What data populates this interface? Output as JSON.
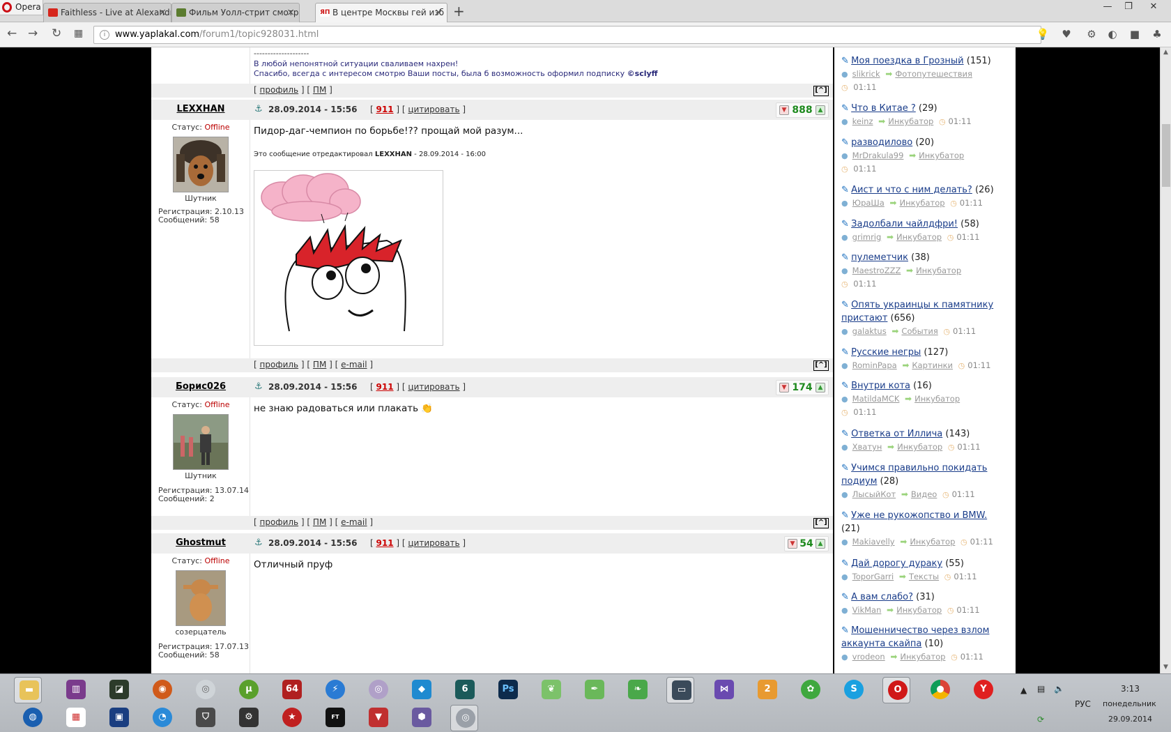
{
  "browser": {
    "brand": "Opera",
    "tabs": [
      {
        "title": "Faithless - Live at Alexandr",
        "fav_color": "#d6261c"
      },
      {
        "title": "Фильм Уолл-стрит смотр",
        "fav_color": "#5b7c2f"
      },
      {
        "title": "В центре Москвы гей изб",
        "fav_color": "#cc1111",
        "active": true
      }
    ],
    "url_host": "www.yaplakal.com",
    "url_path": "/forum1/topic928031.html"
  },
  "forum": {
    "prev_post": {
      "sig_line": "--------------------",
      "sig_text1": "В любой непонятной ситуации сваливаем нахрен!",
      "sig_text2": "Спасибо, всегда с интересом смотрю Ваши посты, была б возможность оформил подписку",
      "sig_author": "©sclyff",
      "footer": {
        "profile": "профиль",
        "pm": "ПМ"
      }
    },
    "posts": [
      {
        "user": "LEXXHAN",
        "date": "28.09.2014 - 15:56",
        "n911": "911",
        "quote": "цитировать",
        "rating": "888",
        "status_label": "Статус:",
        "status": "Offline",
        "rank": "Шутник",
        "reg_label": "Регистрация: 2.10.13",
        "msgs_label": "Сообщений: 58",
        "text": "Пидор-даг-чемпион по борьбе!?? прощай мой разум...",
        "edit_note_prefix": "Это сообщение отредактировал",
        "edit_note_user": "LEXXHAN",
        "edit_note_date": "- 28.09.2014 - 16:00",
        "footer": {
          "profile": "профиль",
          "pm": "ПМ",
          "email": "e-mail"
        }
      },
      {
        "user": "Борис026",
        "date": "28.09.2014 - 15:56",
        "n911": "911",
        "quote": "цитировать",
        "rating": "174",
        "status_label": "Статус:",
        "status": "Offline",
        "rank": "Шутник",
        "reg_label": "Регистрация: 13.07.14",
        "msgs_label": "Сообщений: 2",
        "text": "не знаю радоваться или плакать",
        "footer": {
          "profile": "профиль",
          "pm": "ПМ",
          "email": "e-mail"
        }
      },
      {
        "user": "Ghostmut",
        "date": "28.09.2014 - 15:56",
        "n911": "911",
        "quote": "цитировать",
        "rating": "54",
        "status_label": "Статус:",
        "status": "Offline",
        "rank": "созерцатель",
        "reg_label": "Регистрация: 17.07.13",
        "msgs_label": "Сообщений: 58",
        "text": "Отличный пруф"
      }
    ]
  },
  "sidebar": {
    "items": [
      {
        "title": "Моя поездка в Грозный",
        "count": "(151)",
        "user": "slikrick",
        "section": "Фотопутешествия",
        "time": "01:11"
      },
      {
        "title": "Что в Китае ?",
        "count": "(29)",
        "user": "keinz",
        "section": "Инкубатор",
        "time": "01:11"
      },
      {
        "title": "разводилово",
        "count": "(20)",
        "user": "MrDrakula99",
        "section": "Инкубатор",
        "time": "01:11"
      },
      {
        "title": "Аист и что с ним делать?",
        "count": "(26)",
        "user": "ЮраШа",
        "section": "Инкубатор",
        "time": "01:11"
      },
      {
        "title": "Задолбали чайлдфри!",
        "count": "(58)",
        "user": "grimrig",
        "section": "Инкубатор",
        "time": "01:11"
      },
      {
        "title": "пулеметчик",
        "count": "(38)",
        "user": "MaestroZZZ",
        "section": "Инкубатор",
        "time": "01:11"
      },
      {
        "title1": "Опять украинцы к памятнику",
        "title2": "пристают",
        "count": "(656)",
        "user": "galaktus",
        "section": "События",
        "time": "01:11"
      },
      {
        "title": "Русские негры",
        "count": "(127)",
        "user": "RominPapa",
        "section": "Картинки",
        "time": "01:11"
      },
      {
        "title": "Внутри кота",
        "count": "(16)",
        "user": "MatildaMCK",
        "section": "Инкубатор",
        "time": "01:11"
      },
      {
        "title": "Ответка от Иллича",
        "count": "(143)",
        "user": "Хватун",
        "section": "Инкубатор",
        "time": "01:11"
      },
      {
        "title1": "Учимся правильно покидать",
        "title2": "подиум",
        "count": "(28)",
        "user": "ЛысыйКот",
        "section": "Видео",
        "time": "01:11"
      },
      {
        "title1": "Уже не рукожопство и BMW.",
        "count": "(21)",
        "user": "Makiavelly",
        "section": "Инкубатор",
        "time": "01:11"
      },
      {
        "title": "Дай дорогу дураку",
        "count": "(55)",
        "user": "ToporGarri",
        "section": "Тексты",
        "time": "01:11"
      },
      {
        "title": "А вам слабо?",
        "count": "(31)",
        "user": "VikMan",
        "section": "Инкубатор",
        "time": "01:11"
      },
      {
        "title1": "Мошенничество через взлом",
        "title2": "аккаунта скайпа",
        "count": "(10)",
        "user": "vrodeon",
        "section": "Инкубатор",
        "time": "01:11"
      }
    ]
  },
  "taskbar": {
    "time": "3:13",
    "day": "понедельник",
    "date": "29.09.2014",
    "lang": "РУС",
    "badge_64": "64",
    "ps": "Ps"
  },
  "colors": {
    "offline": "#bb0000",
    "rating_green": "#1e8a1e",
    "link_blue": "#1a3d8a",
    "n911": "#cc0000"
  }
}
